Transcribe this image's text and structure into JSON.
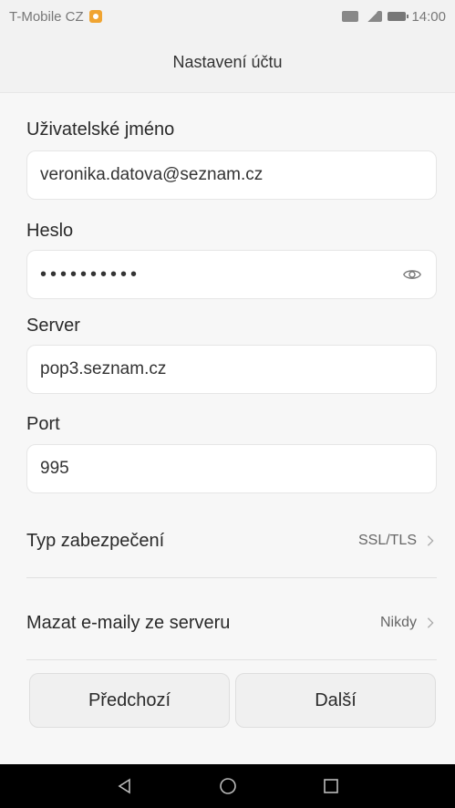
{
  "statusbar": {
    "carrier": "T-Mobile CZ",
    "time": "14:00",
    "icons": [
      "notification-icon",
      "roaming-icon",
      "signal-icon",
      "battery-icon"
    ]
  },
  "header": {
    "title": "Nastavení účtu"
  },
  "form": {
    "username": {
      "label": "Uživatelské jméno",
      "value": "veronika.datova@seznam.cz"
    },
    "password": {
      "label": "Heslo",
      "value": "••••••••••",
      "toggle_icon": "eye-icon"
    },
    "server": {
      "label": "Server",
      "value": "pop3.seznam.cz"
    },
    "port": {
      "label": "Port",
      "value": "995"
    }
  },
  "settings": [
    {
      "label": "Typ zabezpečení",
      "value": "SSL/TLS"
    },
    {
      "label": "Mazat e-maily ze serveru",
      "value": "Nikdy"
    }
  ],
  "buttons": {
    "previous": "Předchozí",
    "next": "Další"
  },
  "colors": {
    "accent_badge": "#f0a431",
    "background": "#f7f7f7",
    "navbar": "#000000"
  },
  "navbar": {
    "icons": [
      "back-icon",
      "home-icon",
      "recents-icon"
    ]
  }
}
